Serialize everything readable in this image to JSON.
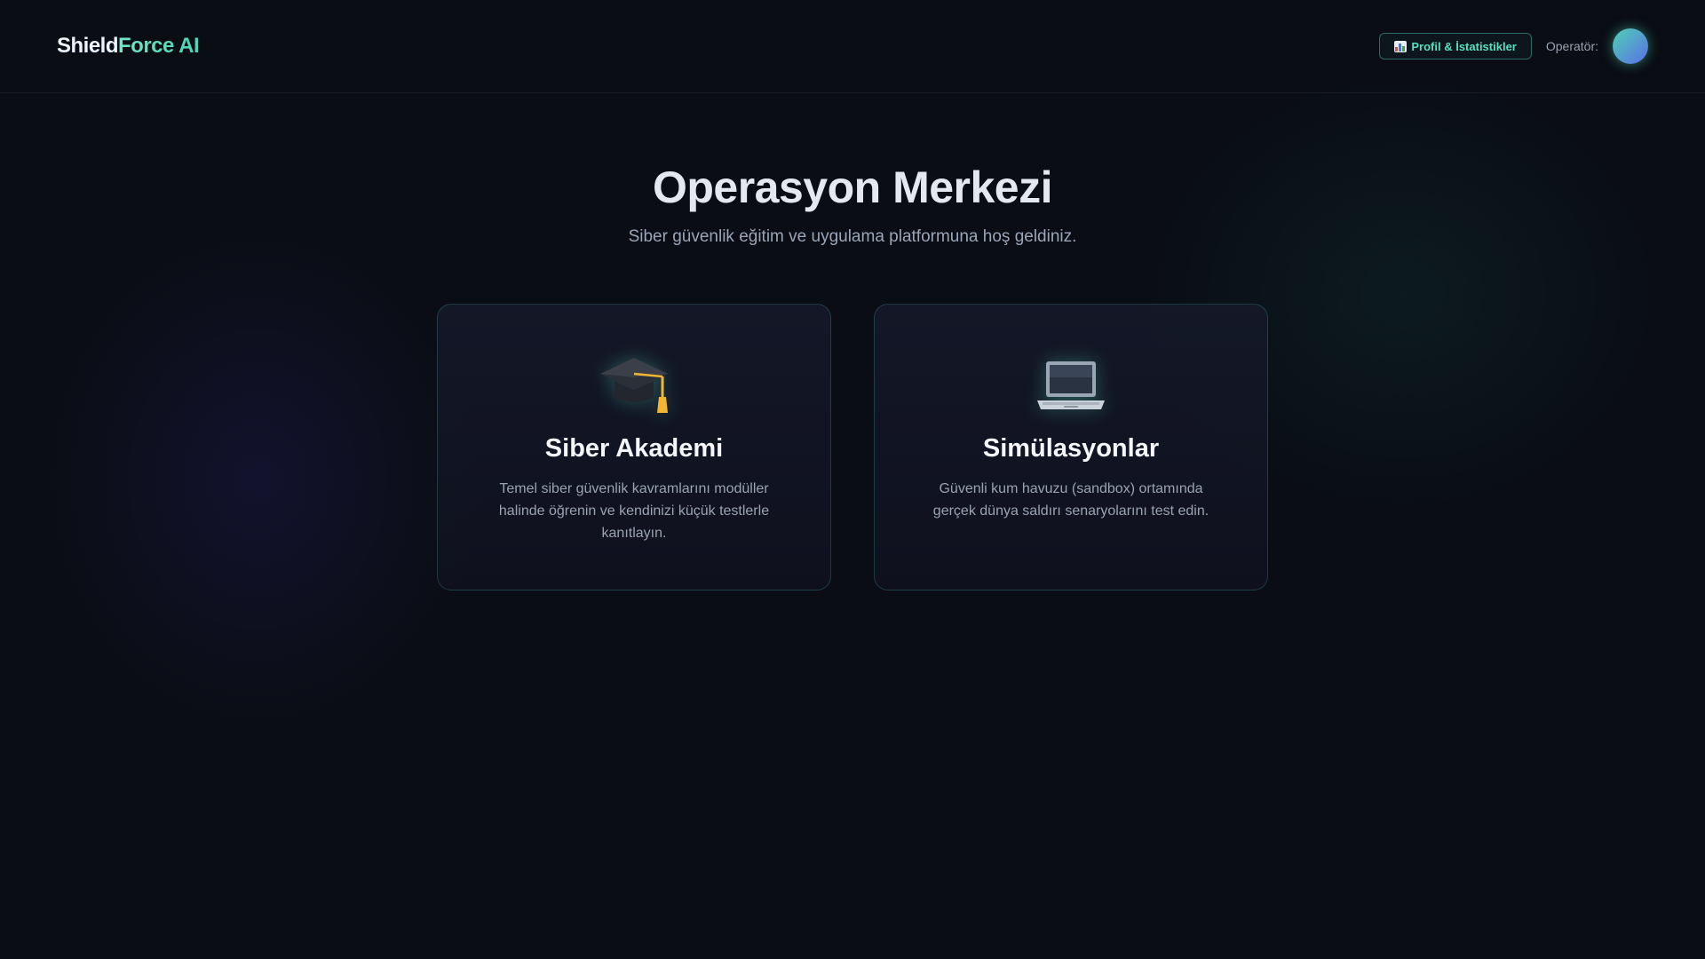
{
  "header": {
    "logo_part1": "Shield",
    "logo_part2": "Force AI",
    "profile_button_label": "Profil & İstatistikler",
    "profile_button_icon": "bar-chart-icon",
    "operator_label": "Operatör:"
  },
  "hero": {
    "title": "Operasyon Merkezi",
    "subtitle": "Siber güvenlik eğitim ve uygulama platformuna hoş geldiniz."
  },
  "cards": [
    {
      "icon": "graduation-cap-icon",
      "title": "Siber Akademi",
      "description": "Temel siber güvenlik kavramlarını modüller halinde öğrenin ve kendinizi küçük testlerle kanıtlayın."
    },
    {
      "icon": "laptop-icon",
      "title": "Simülasyonlar",
      "description": "Güvenli kum havuzu (sandbox) ortamında gerçek dünya saldırı senaryolarını test edin."
    }
  ],
  "colors": {
    "accent": "#4fd1b3",
    "background": "#0a0d14",
    "card_border": "#1f4a44"
  }
}
